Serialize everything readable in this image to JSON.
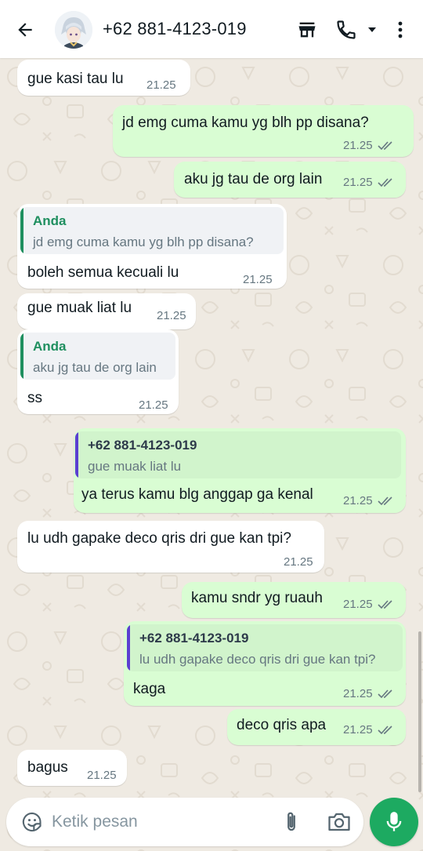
{
  "header": {
    "contact_name": "+62 881-4123-019"
  },
  "colors": {
    "accent_green": "#1daa61",
    "outgoing_bubble": "#d9fdd3",
    "incoming_bubble": "#ffffff",
    "quote_self": "#1f8f5f",
    "quote_other": "#5b3fd1"
  },
  "messages": [
    {
      "dir": "in",
      "text": "gue kasi tau lu",
      "time": "21.25"
    },
    {
      "dir": "out",
      "text": "jd emg cuma kamu yg blh pp disana?",
      "time": "21.25"
    },
    {
      "dir": "out",
      "text": "aku jg tau de org lain",
      "time": "21.25"
    },
    {
      "dir": "in",
      "quote_name": "Anda",
      "quote_text": "jd emg cuma kamu yg blh pp disana?",
      "text": "boleh semua kecuali lu",
      "time": "21.25"
    },
    {
      "dir": "in",
      "text": "gue muak liat lu",
      "time": "21.25"
    },
    {
      "dir": "in",
      "quote_name": "Anda",
      "quote_text": "aku jg tau de org lain",
      "text": "ss",
      "time": "21.25"
    },
    {
      "dir": "out",
      "quote_name": "+62 881-4123-019",
      "quote_text": "gue muak liat lu",
      "text": "ya terus kamu blg anggap ga kenal",
      "time": "21.25"
    },
    {
      "dir": "in",
      "text": "lu udh gapake deco qris dri gue kan tpi?",
      "time": "21.25"
    },
    {
      "dir": "out",
      "text": "kamu sndr yg ruauh",
      "time": "21.25"
    },
    {
      "dir": "out",
      "quote_name": "+62 881-4123-019",
      "quote_text": "lu udh gapake deco qris dri gue kan tpi?",
      "text": "kaga",
      "time": "21.25"
    },
    {
      "dir": "out",
      "text": "deco qris apa",
      "time": "21.25"
    },
    {
      "dir": "in",
      "text": "bagus",
      "time": "21.25"
    }
  ],
  "composer": {
    "placeholder": "Ketik pesan"
  },
  "icons": {
    "back": "arrow-left-icon",
    "store": "store-icon",
    "call": "phone-icon",
    "call_menu": "caret-down-icon",
    "more": "more-vertical-icon",
    "emoji": "sticker-icon",
    "attach": "paperclip-icon",
    "camera": "camera-icon",
    "mic": "microphone-icon"
  }
}
